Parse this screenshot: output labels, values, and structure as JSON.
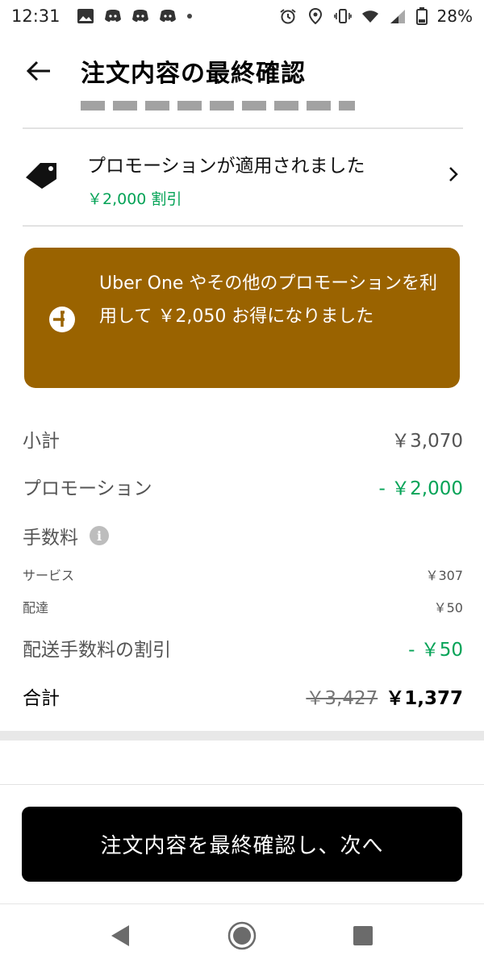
{
  "status_bar": {
    "time": "12:31",
    "battery": "28%"
  },
  "header": {
    "title": "注文内容の最終確認"
  },
  "promotion": {
    "title": "プロモーションが適用されました",
    "amount": "￥2,000 割引"
  },
  "savings_banner": {
    "text": "Uber One やその他のプロモーションを利用して ￥2,050 お得になりました",
    "bg_color": "#9a6300"
  },
  "price_rows": {
    "subtotal_label": "小計",
    "subtotal_value": "￥3,070",
    "promotion_label": "プロモーション",
    "promotion_value": "- ￥2,000",
    "fees_label": "手数料",
    "service_label": "サービス",
    "service_value": "￥307",
    "delivery_label": "配達",
    "delivery_value": "￥50",
    "delivery_discount_label": "配送手数料の割引",
    "delivery_discount_value": "- ￥50",
    "total_label": "合計",
    "total_original": "￥3,427",
    "total_value": "￥1,377"
  },
  "cta": {
    "label": "注文内容を最終確認し、次へ"
  },
  "colors": {
    "accent_green": "#05a357",
    "banner_brown": "#9a6300"
  },
  "icons": [
    "back-arrow-icon",
    "tag-icon",
    "chevron-right-icon",
    "uber-one-icon",
    "info-icon",
    "nav-back-icon",
    "nav-home-icon",
    "nav-recents-icon"
  ]
}
